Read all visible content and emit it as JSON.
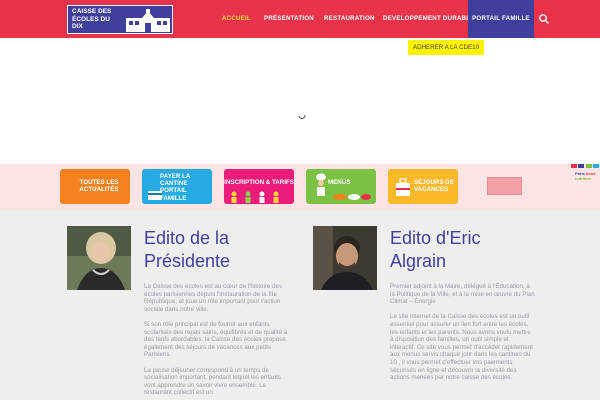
{
  "header": {
    "logo_text": "CAISSE DES ÉCOLES DU DIX",
    "nav": {
      "accueil": "ACCUEIL",
      "presentation": "PRÉSENTATION",
      "restauration": "RESTAURATION",
      "developpement": "DEVELOPPEMENT DURABLE",
      "portail": "PORTAIL FAMILLE"
    },
    "search_icon": "search-icon"
  },
  "adherer_button": "ADHERER A LA CDE10",
  "tiles": {
    "actualites": "TOUTES LES ACTUALITÉS",
    "payer": "PAYER LA CANTINE PORTAIL FAMILLE",
    "inscription": "INSCRIPTION & TARIFS",
    "menus": "MENUS",
    "sejours": "SÉJOURS DE VACANCES"
  },
  "partner": {
    "paris_line1": "Paris",
    "paris_line2": "bons",
    "paris_line3": "nutrition"
  },
  "editos": {
    "presidente": {
      "title": "Edito de la Présidente",
      "p1": "La Caisse des écoles est au cœur de l'histoire des écoles parisiennes depuis l'instauration de la IIIe République, et joue un rôle important pour l'action sociale dans notre ville.",
      "p2": "Si son rôle principal est de fournir aux enfants scolarisés des repas sains, équilibrés et de qualité à des tarifs abordables, la Caisse des écoles propose également des séjours de vacances aux petits Parisiens.",
      "p3": "La pause déjeuner correspond à un temps de socialisation important, pendant lequel les enfants vont apprendre un savoir vivre ensemble. Le restaurant collectif est un"
    },
    "eric": {
      "title": "Edito d'Eric Algrain",
      "p1": "Premier adjoint à la Maire, délégué à l'Éducation, à la Politique de la Ville, et à la mise en œuvre du Plan Climat – Énergie",
      "p2": "Le site internet de la Caisse des écoles est un outil essentiel pour assurer un lien fort entre les écoles, les enfants et les parents.  Nous avons voulu mettre à disposition des familles, un outil simple et interactif. Ce site vous permet d'accéder rapidement aux menus servis chaque jour dans les cantines du 10 , il vous permet d'effectuer vos paiements sécurisés en ligne et découvrir la diversité des actions menées par notre caisse des écoles."
    }
  },
  "colors": {
    "header_red": "#e8334a",
    "brand_blue": "#3f3f9c",
    "active_yellow": "#ffe23c"
  }
}
